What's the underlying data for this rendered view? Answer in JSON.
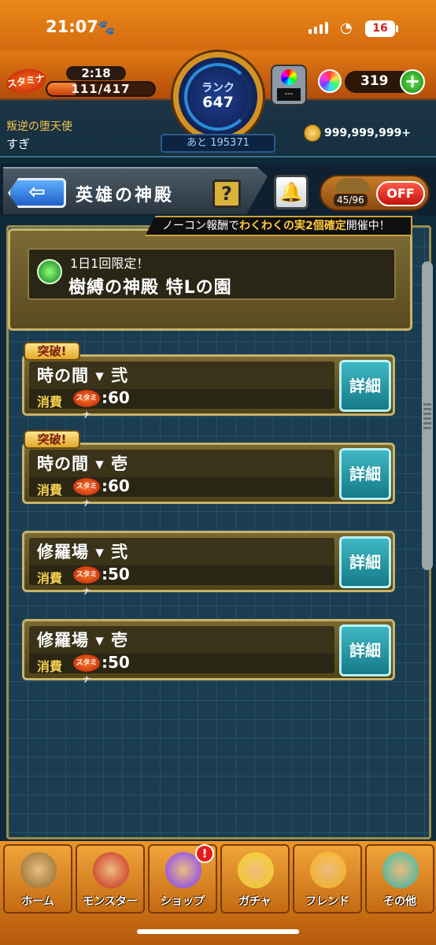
{
  "status_bar": {
    "time": "21:07",
    "battery": "16"
  },
  "header": {
    "stamina_icon_text": "スタミナ",
    "stamina_timer": "2:18",
    "stamina_count": "111/417",
    "stamina_level": 0.266,
    "rank_label": "ランク",
    "rank_value": "647",
    "rank_next": "あと 195371",
    "machine_text": "---",
    "orb_count": "319",
    "plus_label": "+",
    "player_title": "叛逆の堕天使",
    "player_name": "すぎ",
    "coins": "999,999,999+"
  },
  "title_bar": {
    "back_label": "⇦",
    "title": "英雄の神殿",
    "help_label": "?",
    "bell_icon": "bell-icon",
    "auto_count": "45/96",
    "off_label": "OFF"
  },
  "event_banner": {
    "prefix": "ノーコン報酬で",
    "highlight": "わくわくの実2個確定",
    "suffix": "開催中！"
  },
  "feature": {
    "subtitle": "1日1回限定！",
    "title": "樹縛の神殿 特Lの園"
  },
  "quests": [
    {
      "badge": "突破!",
      "name": "時の間 ▾ 弐",
      "cost_label": "消費",
      "cost_icon_text": "スタミナ",
      "cost": ":60",
      "detail_label": "詳細"
    },
    {
      "badge": "突破!",
      "name": "時の間 ▾ 壱",
      "cost_label": "消費",
      "cost_icon_text": "スタミナ",
      "cost": ":60",
      "detail_label": "詳細"
    },
    {
      "badge": "",
      "name": "修羅場 ▾ 弐",
      "cost_label": "消費",
      "cost_icon_text": "スタミナ",
      "cost": ":50",
      "detail_label": "詳細"
    },
    {
      "badge": "",
      "name": "修羅場 ▾ 壱",
      "cost_label": "消費",
      "cost_icon_text": "スタミナ",
      "cost": ":50",
      "detail_label": "詳細"
    }
  ],
  "nav": [
    {
      "label": "ホーム",
      "icon": "home-icon",
      "color": "#8a6a2a"
    },
    {
      "label": "モンスター",
      "icon": "monster-icon",
      "color": "#c8281c"
    },
    {
      "label": "ショップ",
      "icon": "orb-icon",
      "color": "#7a3bff",
      "badge": "!"
    },
    {
      "label": "ガチャ",
      "icon": "gacha-egg-icon",
      "color": "#f5d21a"
    },
    {
      "label": "フレンド",
      "icon": "friend-icon",
      "color": "#f5b21a"
    },
    {
      "label": "その他",
      "icon": "other-icon",
      "color": "#2ab8a8"
    }
  ],
  "colors": {
    "accent_orange": "#e88a18",
    "detail_teal": "#3fb8c4",
    "off_red": "#ff5a4a",
    "banner_highlight": "#ffc83a"
  }
}
